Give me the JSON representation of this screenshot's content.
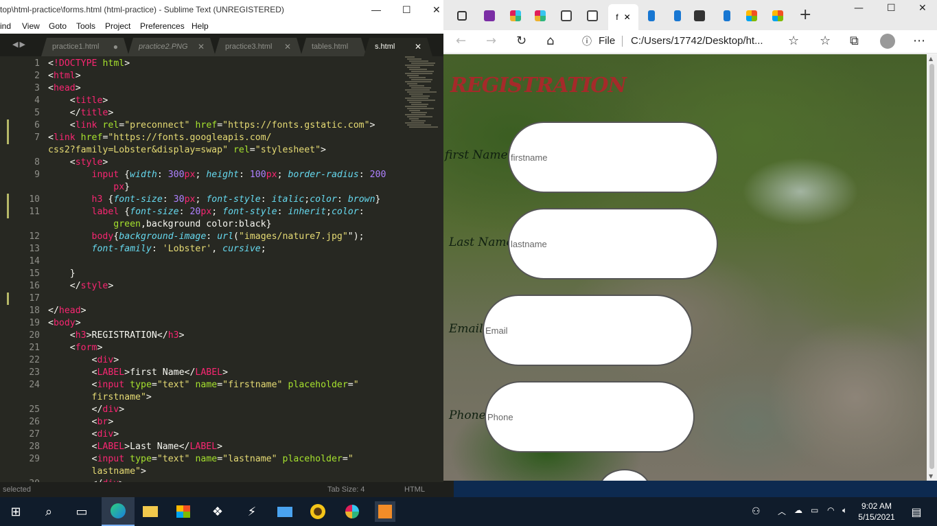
{
  "sublime": {
    "title": "top\\html-practice\\forms.html (html-practice) - Sublime Text (UNREGISTERED)",
    "menu": [
      "ind",
      "View",
      "Goto",
      "Tools",
      "Project",
      "Preferences",
      "Help"
    ],
    "tabs": [
      {
        "label": "practice1.html",
        "close": "●",
        "italic": false
      },
      {
        "label": "practice2.PNG",
        "close": "✕",
        "italic": true
      },
      {
        "label": "practice3.html",
        "close": "✕",
        "italic": false
      },
      {
        "label": "tables.html",
        "close": "✕",
        "italic": false
      },
      {
        "label": "s.html",
        "close": "✕",
        "italic": false,
        "active": true
      }
    ],
    "line_numbers": [
      "1",
      "2",
      "3",
      "4",
      "5",
      "6",
      "7",
      "",
      "8",
      "9",
      "",
      "10",
      "11",
      "",
      "12",
      "13",
      "14",
      "15",
      "16",
      "17",
      "18",
      "19",
      "20",
      "21",
      "22",
      "23",
      "24",
      "",
      "25",
      "26",
      "27",
      "28",
      "29",
      "",
      "30"
    ],
    "status_left": "selected",
    "status_tab": "Tab Size: 4",
    "status_syntax": "HTML"
  },
  "edge": {
    "tab_active_label": "f",
    "tab_active_close": "✕",
    "new_tab": "+",
    "addr_file": "File",
    "addr_url": "C:/Users/17742/Desktop/ht...",
    "page": {
      "heading": "REGISTRATION",
      "fields": [
        {
          "label": "first Name",
          "placeholder": "firstname"
        },
        {
          "label": "Last Name",
          "placeholder": "lastname"
        },
        {
          "label": "Email",
          "placeholder": "Email"
        },
        {
          "label": "Phone",
          "placeholder": "Phone"
        }
      ]
    }
  },
  "taskbar": {
    "time": "9:02 AM",
    "date": "5/15/2021"
  }
}
